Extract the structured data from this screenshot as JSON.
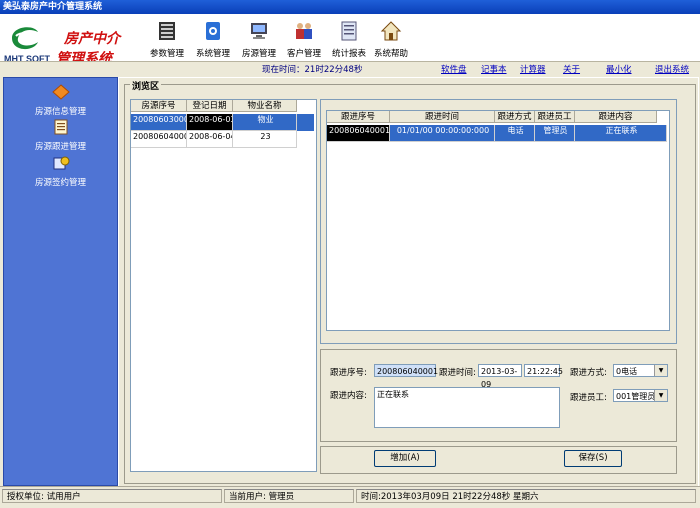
{
  "window": {
    "title": "美弘泰房产中介管理系统"
  },
  "header": {
    "logo_text": "MHT SOFT",
    "brand_line1": "房产中介",
    "brand_line2": "管理系统"
  },
  "toolbar": [
    {
      "label": "参数管理",
      "icon": "params-icon"
    },
    {
      "label": "系统管理",
      "icon": "system-icon"
    },
    {
      "label": "房源管理",
      "icon": "house-source-icon"
    },
    {
      "label": "客户管理",
      "icon": "customer-icon"
    },
    {
      "label": "统计报表",
      "icon": "report-icon"
    },
    {
      "label": "系统帮助",
      "icon": "help-home-icon"
    }
  ],
  "statusline": {
    "time_now": "现在时间：21时22分48秒",
    "links": [
      "软件盘",
      "记事本",
      "计算器",
      "关于",
      "最小化",
      "退出系统"
    ]
  },
  "sidebar": {
    "items": [
      {
        "label": "房源信息管理",
        "icon": "diamond-icon"
      },
      {
        "label": "房源跟进管理",
        "icon": "notepad-icon"
      },
      {
        "label": "房源签约管理",
        "icon": "contract-icon"
      }
    ]
  },
  "browse": {
    "group_label": "浏览区",
    "left_table": {
      "headers": [
        "房源序号",
        "登记日期",
        "物业名称"
      ],
      "rows": [
        [
          "200806030001",
          "2008-06-03",
          "物业"
        ],
        [
          "200806040001",
          "2008-06-04",
          "23"
        ]
      ]
    },
    "right_table": {
      "headers": [
        "跟进序号",
        "跟进时间",
        "跟进方式",
        "跟进员工",
        "跟进内容"
      ],
      "rows": [
        [
          "200806040001",
          "01/01/00 00:00:00:000",
          "电话",
          "管理员",
          "正在联系"
        ]
      ]
    }
  },
  "form": {
    "seq_label": "跟进序号:",
    "seq_value": "200806040001",
    "time_label": "跟进时间:",
    "date_value": "2013-03-09",
    "time_value": "21:22:45",
    "method_label": "跟进方式:",
    "method_value": "0电话",
    "content_label": "跟进内容:",
    "content_value": "正在联系",
    "staff_label": "跟进员工:",
    "staff_value": "001管理员"
  },
  "buttons": {
    "add": "增加(A)",
    "save": "保存(S)"
  },
  "bottombar": {
    "auth": "授权单位: 试用用户",
    "current_user": "当前用户: 管理员",
    "time": "时间:2013年03月09日 21时22分48秒 星期六"
  }
}
